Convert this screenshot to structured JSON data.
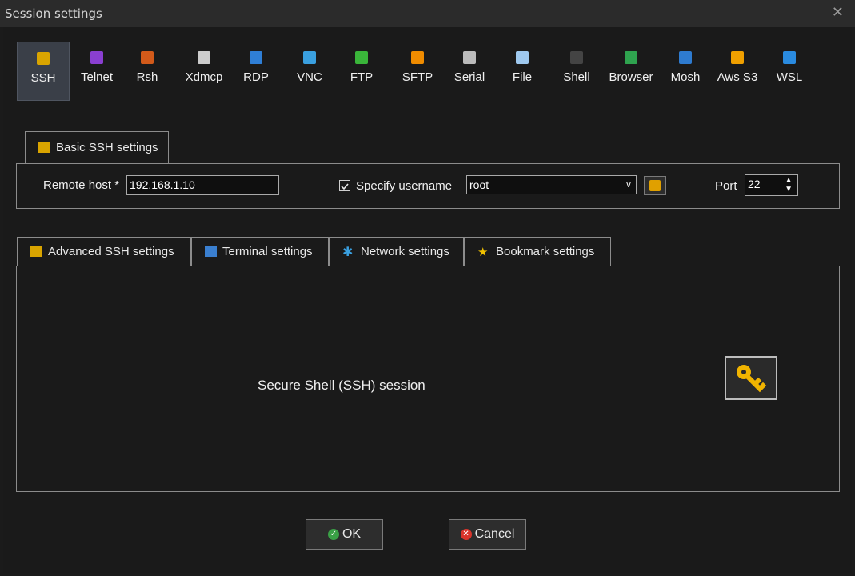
{
  "window": {
    "title": "Session settings"
  },
  "protocols": [
    {
      "label": "SSH",
      "icon": "key-icon",
      "color": "#d9a400",
      "active": true
    },
    {
      "label": "Telnet",
      "icon": "telnet-icon",
      "color": "#8a3fd1"
    },
    {
      "label": "Rsh",
      "icon": "rsh-icon",
      "color": "#d25a1a"
    },
    {
      "label": "Xdmcp",
      "icon": "x-icon",
      "color": "#cccccc"
    },
    {
      "label": "RDP",
      "icon": "rdp-icon",
      "color": "#2f7fd6"
    },
    {
      "label": "VNC",
      "icon": "vnc-icon",
      "color": "#3aa0e0"
    },
    {
      "label": "FTP",
      "icon": "globe-icon",
      "color": "#3ab53a"
    },
    {
      "label": "SFTP",
      "icon": "sftp-icon",
      "color": "#f08c00"
    },
    {
      "label": "Serial",
      "icon": "plug-icon",
      "color": "#bbbbbb"
    },
    {
      "label": "File",
      "icon": "file-icon",
      "color": "#9fc9ef"
    },
    {
      "label": "Shell",
      "icon": "terminal-icon",
      "color": "#444444"
    },
    {
      "label": "Browser",
      "icon": "browser-globe-icon",
      "color": "#2fa34f"
    },
    {
      "label": "Mosh",
      "icon": "satellite-icon",
      "color": "#2e7bd0"
    },
    {
      "label": "Aws S3",
      "icon": "aws-icon",
      "color": "#f0a000"
    },
    {
      "label": "WSL",
      "icon": "windows-icon",
      "color": "#2a8be0"
    }
  ],
  "basic": {
    "tab_label": "Basic SSH settings",
    "remote_host_label": "Remote host *",
    "remote_host_value": "192.168.1.10",
    "specify_username_label": "Specify username",
    "username_value": "root",
    "port_label": "Port",
    "port_value": "22"
  },
  "tabs": [
    {
      "label": "Advanced SSH settings",
      "icon": "key-icon"
    },
    {
      "label": "Terminal settings",
      "icon": "terminal-icon"
    },
    {
      "label": "Network settings",
      "icon": "network-icon"
    },
    {
      "label": "Bookmark settings",
      "icon": "star-icon"
    }
  ],
  "content": {
    "description": "Secure Shell (SSH) session"
  },
  "buttons": {
    "ok": "OK",
    "cancel": "Cancel"
  },
  "colors": {
    "accent": "#d9a400",
    "ok_green": "#3aa046",
    "cancel_red": "#d9342b",
    "panel_border": "#8c8c8c"
  }
}
